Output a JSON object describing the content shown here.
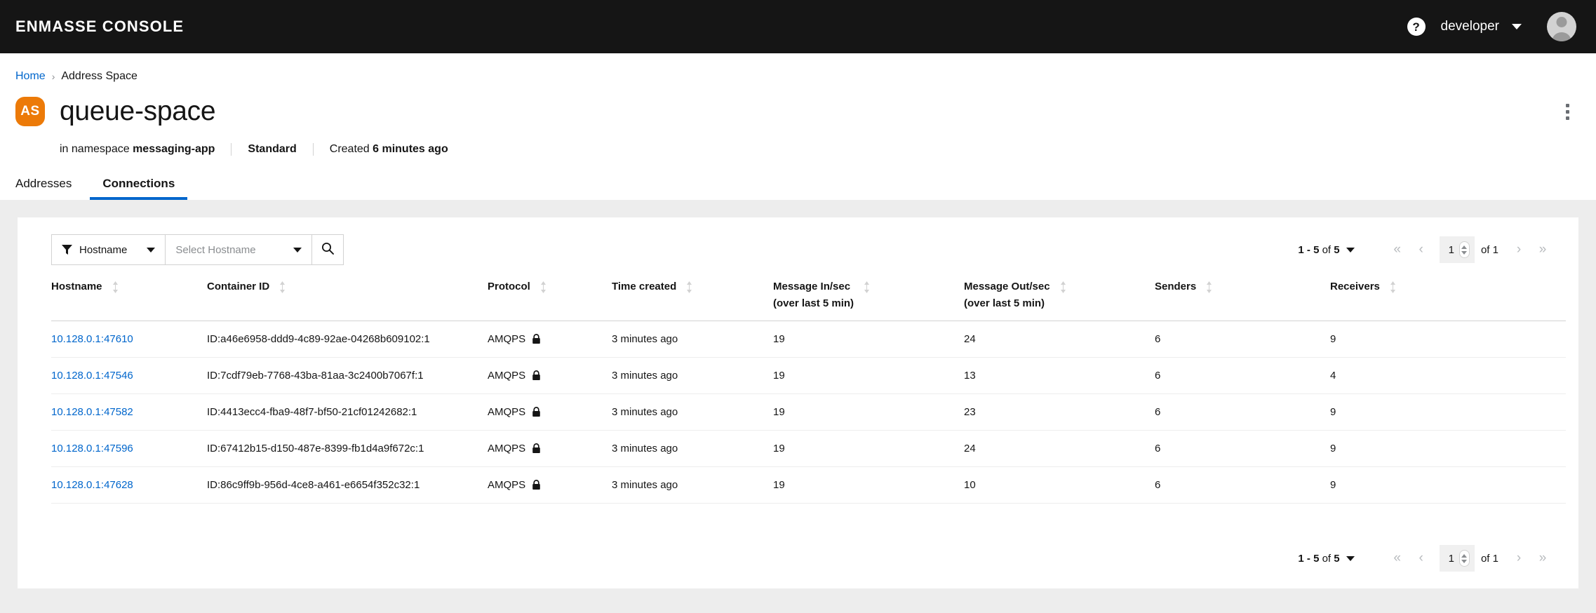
{
  "masthead": {
    "brand": "ENMASSE CONSOLE",
    "help_icon": "question-circle-icon",
    "user": "developer",
    "avatar_icon": "user-avatar-icon"
  },
  "breadcrumb": {
    "home": "Home",
    "separator": "›",
    "current": "Address Space"
  },
  "header": {
    "badge": "AS",
    "title": "queue-space",
    "kebab_icon": "kebab-vertical-icon",
    "meta": {
      "namespace_prefix": "in namespace ",
      "namespace": "messaging-app",
      "plan": "Standard",
      "created_prefix": "Created ",
      "created": "6 minutes ago"
    }
  },
  "tabs": [
    {
      "label": "Addresses",
      "active": false
    },
    {
      "label": "Connections",
      "active": true
    }
  ],
  "toolbar": {
    "filter_icon": "filter-funnel-icon",
    "filter_label": "Hostname",
    "typeahead_placeholder": "Select Hostname",
    "typeahead_value": "",
    "search_icon": "search-icon"
  },
  "pagination": {
    "summary_range": "1 - 5",
    "summary_of": " of ",
    "summary_total": "5",
    "first_icon": "«",
    "prev_icon": "‹",
    "page_value": "1",
    "of_pages": "of 1",
    "next_icon": "›",
    "last_icon": "»"
  },
  "table": {
    "columns": [
      {
        "label": "Hostname",
        "sub": ""
      },
      {
        "label": "Container ID",
        "sub": ""
      },
      {
        "label": "Protocol",
        "sub": ""
      },
      {
        "label": "Time created",
        "sub": ""
      },
      {
        "label": "Message In/sec",
        "sub": "(over last 5 min)"
      },
      {
        "label": "Message Out/sec",
        "sub": "(over last 5 min)"
      },
      {
        "label": "Senders",
        "sub": ""
      },
      {
        "label": "Receivers",
        "sub": ""
      }
    ],
    "rows": [
      {
        "hostname": "10.128.0.1:47610",
        "container_id": "ID:a46e6958-ddd9-4c89-92ae-04268b609102:1",
        "protocol": "AMQPS",
        "secure_icon": "lock-icon",
        "time_created": "3 minutes ago",
        "message_in": "19",
        "message_out": "24",
        "senders": "6",
        "receivers": "9"
      },
      {
        "hostname": "10.128.0.1:47546",
        "container_id": "ID:7cdf79eb-7768-43ba-81aa-3c2400b7067f:1",
        "protocol": "AMQPS",
        "secure_icon": "lock-icon",
        "time_created": "3 minutes ago",
        "message_in": "19",
        "message_out": "13",
        "senders": "6",
        "receivers": "4"
      },
      {
        "hostname": "10.128.0.1:47582",
        "container_id": "ID:4413ecc4-fba9-48f7-bf50-21cf01242682:1",
        "protocol": "AMQPS",
        "secure_icon": "lock-icon",
        "time_created": "3 minutes ago",
        "message_in": "19",
        "message_out": "23",
        "senders": "6",
        "receivers": "9"
      },
      {
        "hostname": "10.128.0.1:47596",
        "container_id": "ID:67412b15-d150-487e-8399-fb1d4a9f672c:1",
        "protocol": "AMQPS",
        "secure_icon": "lock-icon",
        "time_created": "3 minutes ago",
        "message_in": "19",
        "message_out": "24",
        "senders": "6",
        "receivers": "9"
      },
      {
        "hostname": "10.128.0.1:47628",
        "container_id": "ID:86c9ff9b-956d-4ce8-a461-e6654f352c32:1",
        "protocol": "AMQPS",
        "secure_icon": "lock-icon",
        "time_created": "3 minutes ago",
        "message_in": "19",
        "message_out": "10",
        "senders": "6",
        "receivers": "9"
      }
    ]
  },
  "colors": {
    "masthead_bg": "#151515",
    "link": "#0066cc",
    "accent_tab": "#0066cc",
    "badge_orange": "#ec7a08",
    "page_bg": "#ededed",
    "card_bg": "#ffffff",
    "border": "#d2d2d2"
  }
}
